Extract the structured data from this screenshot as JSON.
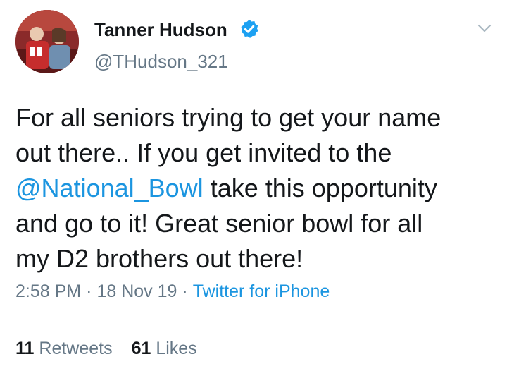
{
  "user": {
    "display_name": "Tanner Hudson",
    "handle": "@THudson_321",
    "verified_icon": "verified-badge-icon",
    "avatar": "profile-photo"
  },
  "tweet": {
    "text_lines": [
      {
        "parts": [
          "For all seniors trying to get your name"
        ]
      },
      {
        "parts": [
          "out there.. If you get invited to the"
        ]
      },
      {
        "mention": "@National_Bowl",
        "rest": " take this opportunity"
      },
      {
        "parts": [
          "and go to it! Great senior bowl for all"
        ]
      },
      {
        "parts": [
          "my D2 brothers out there!"
        ]
      }
    ],
    "time": "2:58 PM",
    "date": "18 Nov 19",
    "separator": "·",
    "source": "Twitter for iPhone"
  },
  "stats": {
    "retweets_count": "11",
    "retweets_label": "Retweets",
    "likes_count": "61",
    "likes_label": "Likes"
  },
  "colors": {
    "link": "#1b95e0",
    "secondary_text": "#657786",
    "primary_text": "#14171a",
    "divider": "#e1e8ed",
    "verified": "#1da1f2"
  },
  "icons": {
    "menu": "chevron-down-icon"
  }
}
